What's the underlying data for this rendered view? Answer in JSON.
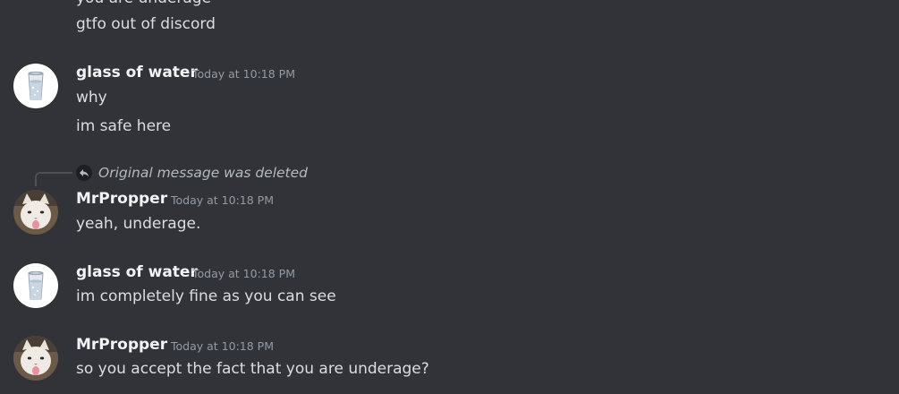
{
  "messages": [
    {
      "lines": [
        "you are underage",
        "gtfo out of discord"
      ]
    },
    {
      "author": "glass of water",
      "timestamp": "Today at 10:18 PM",
      "avatar_icon": "glass-of-water-icon",
      "lines": [
        "why",
        "im safe here"
      ]
    },
    {
      "reply": {
        "icon": "reply-arrow-icon",
        "text": "Original message was deleted"
      },
      "author": "MrPropper",
      "timestamp": "Today at 10:18 PM",
      "avatar_icon": "cat-avatar-icon",
      "lines": [
        "yeah, underage."
      ]
    },
    {
      "author": "glass of water",
      "timestamp": "Today at 10:18 PM",
      "avatar_icon": "glass-of-water-icon",
      "lines": [
        "im completely fine as you can see"
      ]
    },
    {
      "author": "MrPropper",
      "timestamp": "Today at 10:18 PM",
      "avatar_icon": "cat-avatar-icon",
      "lines": [
        "so you accept the fact that you are underage?"
      ]
    }
  ],
  "colors": {
    "background": "#313338",
    "text": "#dbdee1",
    "username": "#f2f3f5",
    "timestamp": "#949ba4",
    "reply_text": "#b5bac1"
  }
}
